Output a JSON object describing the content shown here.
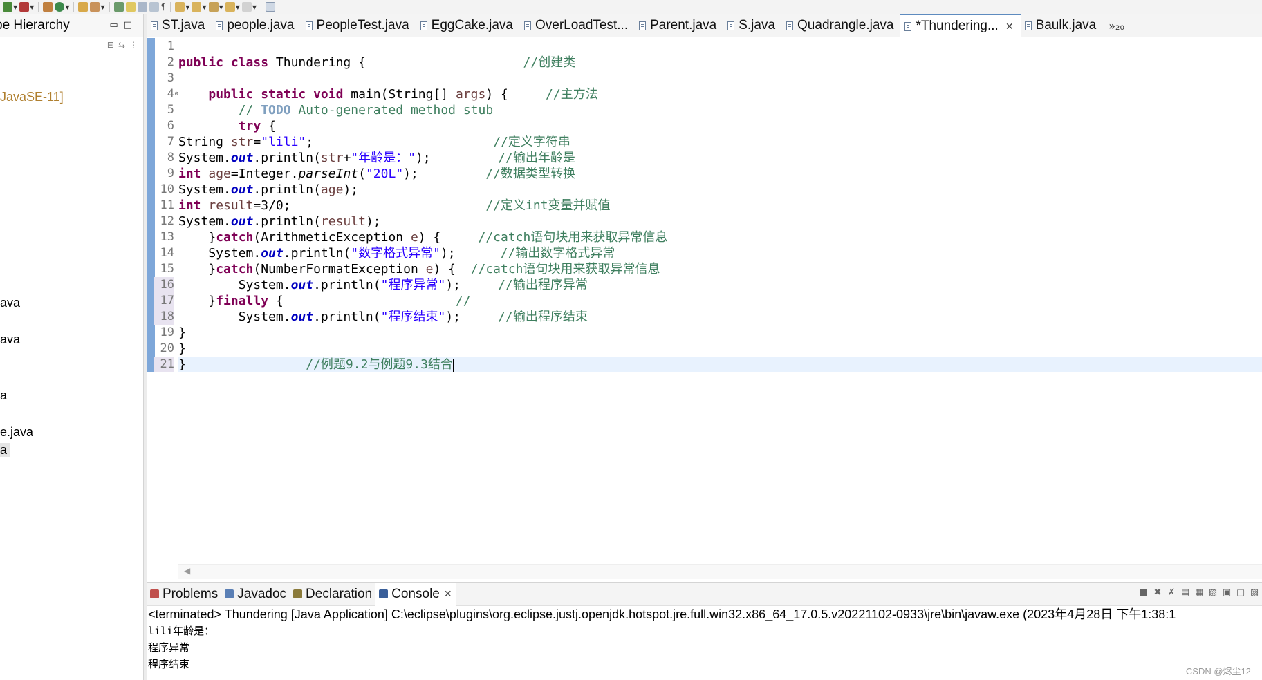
{
  "left_view": {
    "title": "pe Hierarchy",
    "items": [
      "JavaSE-11]",
      "ava",
      "ava",
      "a",
      "e.java",
      "a"
    ]
  },
  "editor": {
    "tabs": [
      {
        "label": "ST.java",
        "active": false
      },
      {
        "label": "people.java",
        "active": false
      },
      {
        "label": "PeopleTest.java",
        "active": false
      },
      {
        "label": "EggCake.java",
        "active": false
      },
      {
        "label": "OverLoadTest...",
        "active": false
      },
      {
        "label": "Parent.java",
        "active": false
      },
      {
        "label": "S.java",
        "active": false
      },
      {
        "label": "Quadrangle.java",
        "active": false
      },
      {
        "label": "*Thundering...",
        "active": true
      },
      {
        "label": "Baulk.java",
        "active": false
      }
    ],
    "more_tabs": "»₂₀",
    "current_line": 21,
    "lines": [
      {
        "n": "1",
        "segs": []
      },
      {
        "n": "2",
        "segs": [
          {
            "t": "public class ",
            "c": "kw"
          },
          {
            "t": "Thundering {",
            "c": ""
          },
          {
            "t": "                     ",
            "c": ""
          },
          {
            "t": "//创建类",
            "c": "cmt"
          }
        ]
      },
      {
        "n": "3",
        "segs": []
      },
      {
        "n": "4",
        "segs": [
          {
            "t": "    ",
            "c": ""
          },
          {
            "t": "public static void ",
            "c": "kw"
          },
          {
            "t": "main(String[] ",
            "c": ""
          },
          {
            "t": "args",
            "c": "var"
          },
          {
            "t": ") {     ",
            "c": ""
          },
          {
            "t": "//主方法",
            "c": "cmt"
          }
        ]
      },
      {
        "n": "5",
        "segs": [
          {
            "t": "        ",
            "c": ""
          },
          {
            "t": "// ",
            "c": "cmt"
          },
          {
            "t": "TODO",
            "c": "todo"
          },
          {
            "t": " Auto-generated method stub",
            "c": "cmt"
          }
        ]
      },
      {
        "n": "6",
        "segs": [
          {
            "t": "        ",
            "c": ""
          },
          {
            "t": "try",
            "c": "kw"
          },
          {
            "t": " {",
            "c": ""
          }
        ]
      },
      {
        "n": "7",
        "segs": [
          {
            "t": "String ",
            "c": ""
          },
          {
            "t": "str",
            "c": "var"
          },
          {
            "t": "=",
            "c": ""
          },
          {
            "t": "\"lili\"",
            "c": "str"
          },
          {
            "t": ";                        ",
            "c": ""
          },
          {
            "t": "//定义字符串",
            "c": "cmt"
          }
        ]
      },
      {
        "n": "8",
        "segs": [
          {
            "t": "System.",
            "c": ""
          },
          {
            "t": "out",
            "c": "fld"
          },
          {
            "t": ".println(",
            "c": ""
          },
          {
            "t": "str",
            "c": "var"
          },
          {
            "t": "+",
            "c": ""
          },
          {
            "t": "\"年龄是：\"",
            "c": "str"
          },
          {
            "t": ");         ",
            "c": ""
          },
          {
            "t": "//输出年龄是",
            "c": "cmt"
          }
        ]
      },
      {
        "n": "9",
        "segs": [
          {
            "t": "int",
            "c": "kw"
          },
          {
            "t": " ",
            "c": ""
          },
          {
            "t": "age",
            "c": "var"
          },
          {
            "t": "=Integer.",
            "c": ""
          },
          {
            "t": "parseInt",
            "c": "mth"
          },
          {
            "t": "(",
            "c": ""
          },
          {
            "t": "\"20L\"",
            "c": "str"
          },
          {
            "t": ");         ",
            "c": ""
          },
          {
            "t": "//数据类型转换",
            "c": "cmt"
          }
        ]
      },
      {
        "n": "10",
        "segs": [
          {
            "t": "System.",
            "c": ""
          },
          {
            "t": "out",
            "c": "fld"
          },
          {
            "t": ".println(",
            "c": ""
          },
          {
            "t": "age",
            "c": "var"
          },
          {
            "t": ");",
            "c": ""
          }
        ]
      },
      {
        "n": "11",
        "segs": [
          {
            "t": "int",
            "c": "kw"
          },
          {
            "t": " ",
            "c": ""
          },
          {
            "t": "result",
            "c": "var"
          },
          {
            "t": "=3/0;                          ",
            "c": ""
          },
          {
            "t": "//定义int变量并赋值",
            "c": "cmt"
          }
        ]
      },
      {
        "n": "12",
        "segs": [
          {
            "t": "System.",
            "c": ""
          },
          {
            "t": "out",
            "c": "fld"
          },
          {
            "t": ".println(",
            "c": ""
          },
          {
            "t": "result",
            "c": "var"
          },
          {
            "t": ");",
            "c": ""
          }
        ]
      },
      {
        "n": "13",
        "segs": [
          {
            "t": "    }",
            "c": ""
          },
          {
            "t": "catch",
            "c": "kw"
          },
          {
            "t": "(ArithmeticException ",
            "c": ""
          },
          {
            "t": "e",
            "c": "var"
          },
          {
            "t": ") {     ",
            "c": ""
          },
          {
            "t": "//catch语句块用来获取异常信息",
            "c": "cmt"
          }
        ]
      },
      {
        "n": "14",
        "segs": [
          {
            "t": "    System.",
            "c": ""
          },
          {
            "t": "out",
            "c": "fld"
          },
          {
            "t": ".println(",
            "c": ""
          },
          {
            "t": "\"数字格式异常\"",
            "c": "str"
          },
          {
            "t": ");      ",
            "c": ""
          },
          {
            "t": "//输出数字格式异常",
            "c": "cmt"
          }
        ]
      },
      {
        "n": "15",
        "segs": [
          {
            "t": "    }",
            "c": ""
          },
          {
            "t": "catch",
            "c": "kw"
          },
          {
            "t": "(NumberFormatException ",
            "c": ""
          },
          {
            "t": "e",
            "c": "var"
          },
          {
            "t": ") {  ",
            "c": ""
          },
          {
            "t": "//catch语句块用来获取异常信息",
            "c": "cmt"
          }
        ]
      },
      {
        "n": "16",
        "segs": [
          {
            "t": "        System.",
            "c": ""
          },
          {
            "t": "out",
            "c": "fld"
          },
          {
            "t": ".println(",
            "c": ""
          },
          {
            "t": "\"程序异常\"",
            "c": "str"
          },
          {
            "t": ");     ",
            "c": ""
          },
          {
            "t": "//输出程序异常",
            "c": "cmt"
          }
        ]
      },
      {
        "n": "17",
        "segs": [
          {
            "t": "    }",
            "c": ""
          },
          {
            "t": "finally",
            "c": "kw"
          },
          {
            "t": " {                       ",
            "c": ""
          },
          {
            "t": "//",
            "c": "cmt"
          }
        ]
      },
      {
        "n": "18",
        "segs": [
          {
            "t": "        System.",
            "c": ""
          },
          {
            "t": "out",
            "c": "fld"
          },
          {
            "t": ".println(",
            "c": ""
          },
          {
            "t": "\"程序结束\"",
            "c": "str"
          },
          {
            "t": ");     ",
            "c": ""
          },
          {
            "t": "//输出程序结束",
            "c": "cmt"
          }
        ]
      },
      {
        "n": "19",
        "segs": [
          {
            "t": "}",
            "c": ""
          }
        ]
      },
      {
        "n": "20",
        "segs": [
          {
            "t": "}",
            "c": ""
          }
        ]
      },
      {
        "n": "21",
        "segs": [
          {
            "t": "}",
            "c": ""
          },
          {
            "t": "                ",
            "c": ""
          },
          {
            "t": "//例题9.2与例题9.3结合",
            "c": "cmt"
          }
        ]
      }
    ]
  },
  "bottom_panel": {
    "tabs": [
      {
        "label": "Problems",
        "icon": "problems-icon",
        "active": false
      },
      {
        "label": "Javadoc",
        "icon": "at-icon",
        "active": false
      },
      {
        "label": "Declaration",
        "icon": "declaration-icon",
        "active": false
      },
      {
        "label": "Console",
        "icon": "console-icon",
        "active": true
      }
    ],
    "console_status": "<terminated> Thundering [Java Application] C:\\eclipse\\plugins\\org.eclipse.justj.openjdk.hotspot.jre.full.win32.x86_64_17.0.5.v20221102-0933\\jre\\bin\\javaw.exe  (2023年4月28日 下午1:38:1",
    "console_output": [
      "lili年龄是：",
      "程序异常",
      "程序结束"
    ]
  },
  "watermark": "CSDN @烬尘12",
  "colors": {
    "keyword": "#7f0055",
    "string": "#2a00ff",
    "comment": "#3f7f5f",
    "field": "#0000c0",
    "current_line": "#e8f2fe",
    "ruler": "#7ea7d9"
  }
}
